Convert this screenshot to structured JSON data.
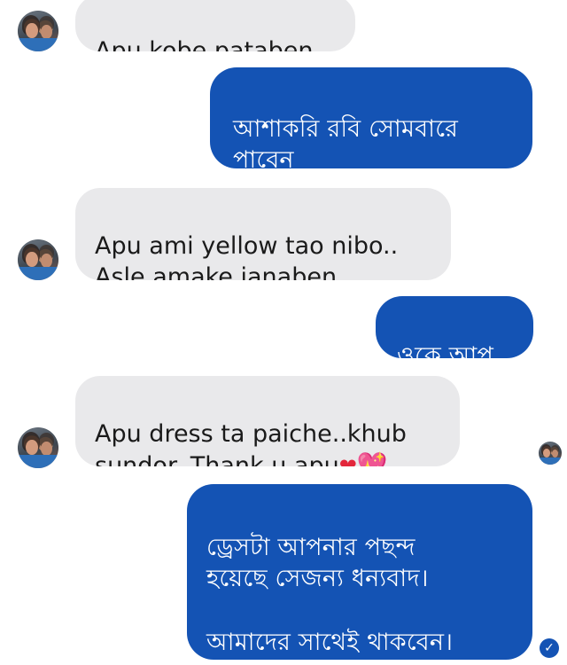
{
  "messages": [
    {
      "id": "m1",
      "from": "in",
      "text": "Apu kobe pataben"
    },
    {
      "id": "m2",
      "from": "out",
      "text": "আশাকরি রবি সোমবারে\nপাবেন"
    },
    {
      "id": "m3",
      "from": "in",
      "text": "Apu ami yellow tao nibo..\nAsle amake janaben"
    },
    {
      "id": "m4",
      "from": "out",
      "text": "ওকে আপু"
    },
    {
      "id": "m5",
      "from": "in",
      "text": "Apu dress ta paiche..khub\nsundor..Thank u apu",
      "emojis": [
        "❤",
        "💖"
      ]
    },
    {
      "id": "m6",
      "from": "out",
      "text": "ড্রেসটা আপনার পছন্দ\nহয়েছে সেজন্য ধন্যবাদ।\n\nআমাদের সাথেই থাকবেন।"
    }
  ],
  "read_receipt_icon": "check-circle-icon"
}
